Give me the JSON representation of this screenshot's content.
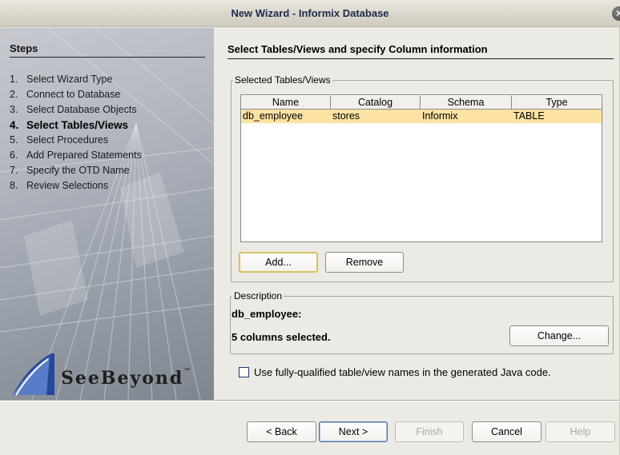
{
  "window": {
    "title": "New Wizard - Informix Database"
  },
  "steps": {
    "header": "Steps",
    "items": [
      {
        "num": "1.",
        "label": "Select Wizard Type"
      },
      {
        "num": "2.",
        "label": "Connect to Database"
      },
      {
        "num": "3.",
        "label": "Select Database Objects"
      },
      {
        "num": "4.",
        "label": "Select Tables/Views"
      },
      {
        "num": "5.",
        "label": "Select Procedures"
      },
      {
        "num": "6.",
        "label": "Add Prepared Statements"
      },
      {
        "num": "7.",
        "label": "Specify the OTD Name"
      },
      {
        "num": "8.",
        "label": "Review Selections"
      }
    ],
    "active_index": 3,
    "logo_text": "SeeBeyond",
    "logo_tm": "™"
  },
  "main": {
    "heading": "Select Tables/Views and specify Column information",
    "tables_group": {
      "legend": "Selected Tables/Views",
      "columns": [
        "Name",
        "Catalog",
        "Schema",
        "Type"
      ],
      "rows": [
        {
          "name": "db_employee",
          "catalog": "stores",
          "schema": "Informix",
          "type": "TABLE"
        }
      ],
      "add_label": "Add...",
      "remove_label": "Remove"
    },
    "description_group": {
      "legend": "Description",
      "line1": "db_employee:",
      "line2": "5 columns selected.",
      "change_label": "Change..."
    },
    "checkbox": {
      "label": "Use fully-qualified table/view names in the generated Java code.",
      "checked": false
    }
  },
  "footer": {
    "back_label": "< Back",
    "next_label": "Next >",
    "finish_label": "Finish",
    "cancel_label": "Cancel",
    "help_label": "Help"
  },
  "colors": {
    "selected_row": "#fde3a3",
    "title_text": "#1d2a4a",
    "focus_border": "#d7c35e"
  }
}
